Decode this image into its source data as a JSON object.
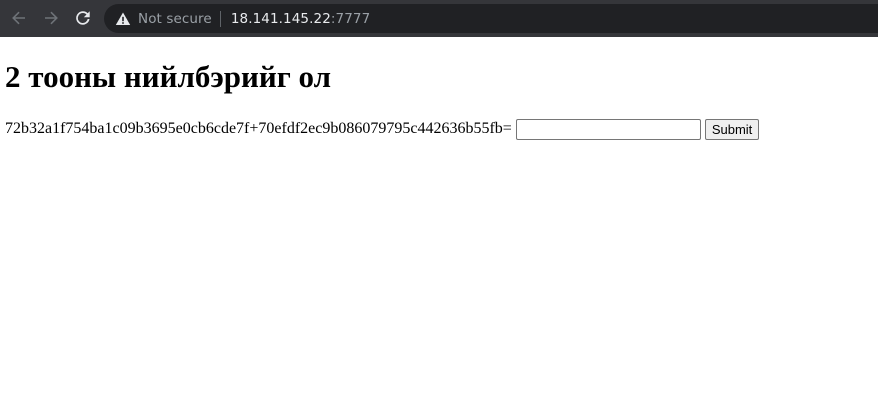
{
  "browser": {
    "security_label": "Not secure",
    "url_host": "18.141.145.22",
    "url_port": ":7777"
  },
  "page": {
    "heading": "2 тооны нийлбэрийг ол",
    "equation": "72b32a1f754ba1c09b3695e0cb6cde7f+70efdf2ec9b086079795c442636b55fb=",
    "input_value": "",
    "submit_label": "Submit"
  }
}
